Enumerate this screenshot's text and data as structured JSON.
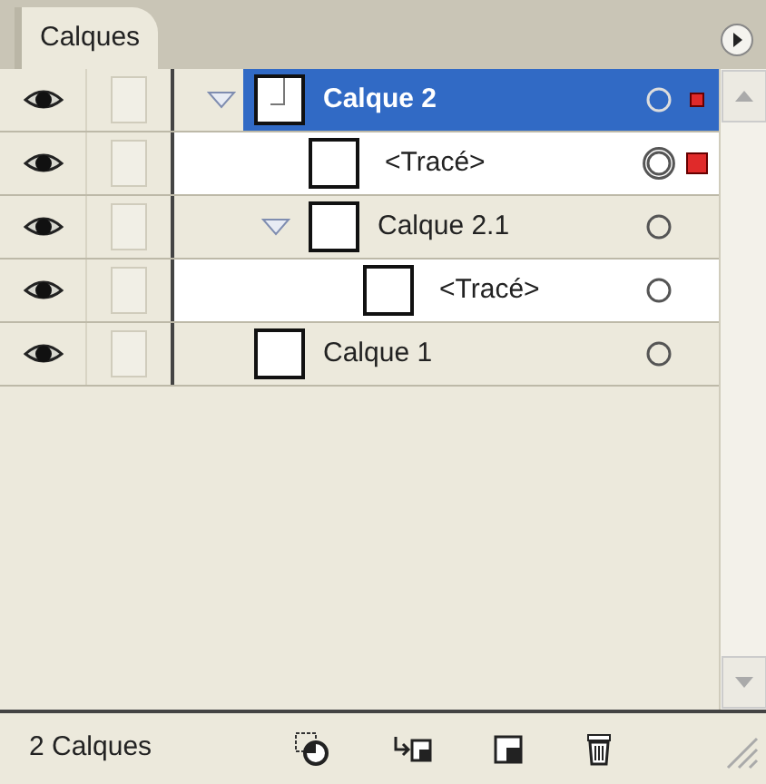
{
  "panel": {
    "tab": "Calques"
  },
  "layers": [
    {
      "kind": "layer",
      "name": "Calque 2",
      "visible": true,
      "locked": false,
      "selected": true,
      "expanded": true,
      "targeted": false,
      "marked": true,
      "children": [
        {
          "kind": "path",
          "name": "<Tracé>",
          "visible": true,
          "locked": false,
          "selected": false,
          "targeted": true,
          "marked": true
        },
        {
          "kind": "layer",
          "name": "Calque 2.1",
          "visible": true,
          "locked": false,
          "selected": false,
          "expanded": true,
          "targeted": false,
          "marked": false,
          "children": [
            {
              "kind": "path",
              "name": "<Tracé>",
              "visible": true,
              "locked": false,
              "selected": false,
              "targeted": false,
              "marked": false
            }
          ]
        }
      ]
    },
    {
      "kind": "layer",
      "name": "Calque 1",
      "visible": true,
      "locked": false,
      "selected": false,
      "targeted": false,
      "marked": false
    }
  ],
  "status": {
    "count": "2 Calques"
  }
}
